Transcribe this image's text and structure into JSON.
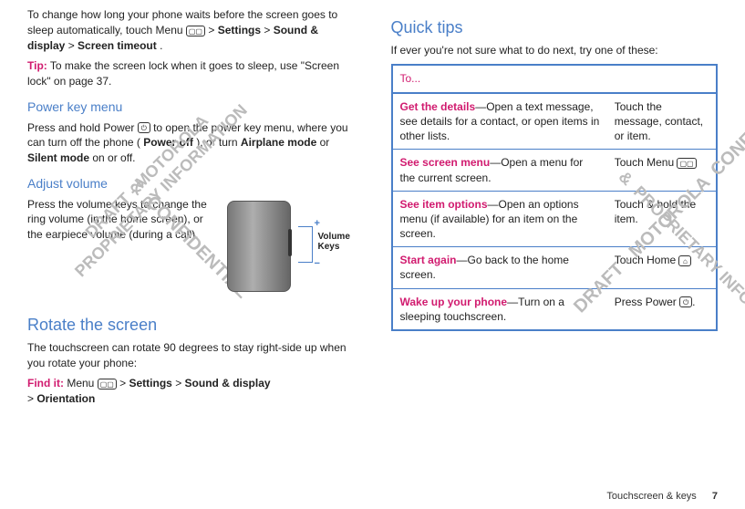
{
  "left": {
    "intro": "To change how long your phone waits before the screen goes to sleep automatically, touch Menu ",
    "intro_path_gt1": "> ",
    "intro_settings": "Settings",
    "intro_gt2": " > ",
    "intro_sound": "Sound & display",
    "intro_gt3": " > ",
    "intro_timeout": "Screen timeout",
    "intro_dot": ".",
    "tip_label": "Tip:",
    "tip_text": " To make the screen lock when it goes to sleep, use \"Screen lock\" on page 37.",
    "power_heading": "Power key menu",
    "power_p_a": "Press and hold Power ",
    "power_p_b": " to open the power key menu, where you can turn off the phone (",
    "power_off": "Power off",
    "power_p_c": "), or turn ",
    "airplane": "Airplane mode",
    "power_p_d": " or ",
    "silent": "Silent mode",
    "power_p_e": " on or off.",
    "adjust_heading": "Adjust volume",
    "adjust_text": "Press the volume keys to change the ring volume (in the home screen), or the earpiece volume (during a call).",
    "vk_label": "Volume Keys",
    "rotate_heading": "Rotate the screen",
    "rotate_text": "The touchscreen can rotate 90 degrees to stay right-side up when you rotate your phone:",
    "findit_label": "Find it:",
    "findit_a": " Menu ",
    "findit_gt1": " > ",
    "findit_settings": "Settings",
    "findit_gt2": " > ",
    "findit_sound": "Sound & display",
    "findit_gt3": " > ",
    "findit_orientation": "Orientation"
  },
  "right": {
    "heading": "Quick tips",
    "intro": "If ever you're not sure what to do next, try one of these:",
    "table_header": "To...",
    "rows": [
      {
        "action": "Get the details",
        "desc": "—Open a text message, see details for a contact, or open items in other lists.",
        "do": "Touch the message, contact, or item."
      },
      {
        "action": "See screen menu",
        "desc": "—Open a menu for the current screen.",
        "do": "Touch Menu "
      },
      {
        "action": "See item options",
        "desc": "—Open an options menu (if available) for an item on the screen.",
        "do": "Touch & hold the item."
      },
      {
        "action": "Start again",
        "desc": "—Go back to the home screen.",
        "do": "Touch Home "
      },
      {
        "action": "Wake up your phone",
        "desc": "—Turn on a sleeping touchscreen.",
        "do": "Press Power "
      },
      {
        "action": "",
        "desc": "",
        "do": ""
      }
    ]
  },
  "watermarks": {
    "w1": "DRAFT - MOTOROLA\nPROPRIETARY INFORMATION",
    "w2": "&  CONFIDENTIAL",
    "w3": "DRAFT - MOTOROLA  CONFIDENTIAL",
    "w4": "&  PROPRIETARY INFORMATION"
  },
  "icons": {
    "menu": "▢▢",
    "power": "⏻",
    "home": "⌂"
  },
  "footer": {
    "section": "Touchscreen & keys",
    "page": "7"
  }
}
